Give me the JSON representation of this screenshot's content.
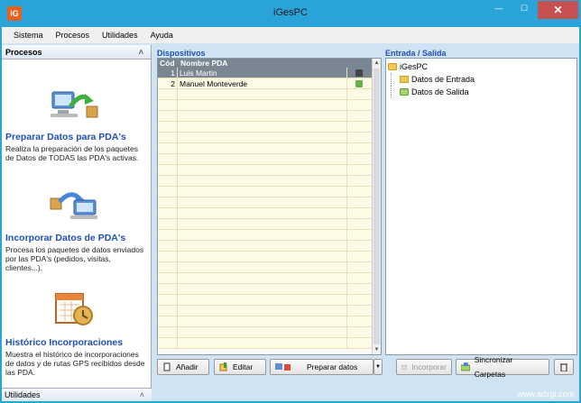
{
  "window": {
    "title": "iGesPC",
    "app_icon_text": "iG",
    "minimize_glyph": "—",
    "maximize_glyph": "☐",
    "close_glyph": "✕"
  },
  "menu": [
    "Sistema",
    "Procesos",
    "Utilidades",
    "Ayuda"
  ],
  "left_pane": {
    "header": "Procesos",
    "collapse_glyph": "˄",
    "footer": "Utilidades",
    "processes": [
      {
        "title": "Preparar Datos para PDA's",
        "description": "Realiza la preparación de los paquetes de Datos de TODAS las PDA's activas.",
        "icon": "computer-to-package-icon"
      },
      {
        "title": "Incorporar Datos de PDA's",
        "description": "Procesa los paquetes de datos enviados por las PDA's (pedidos, visitas, clientes...).",
        "icon": "package-to-computer-icon"
      },
      {
        "title": "Histórico Incorporaciones",
        "description": "Muestra el histórico de incorporaciones de datos y de rutas GPS recibidos desde las PDA.",
        "icon": "history-calendar-icon"
      }
    ]
  },
  "devices": {
    "label": "Dispositivos",
    "columns": [
      "Cód",
      "Nombre PDA"
    ],
    "rows": [
      {
        "cod": "1",
        "name": "Luis Martin",
        "icon": "apple-device-icon",
        "icon_color": "#444444"
      },
      {
        "cod": "2",
        "name": "Manuel Monteverde",
        "icon": "android-device-icon",
        "icon_color": "#6ab04c"
      }
    ]
  },
  "tree": {
    "label": "Entrada / Salida",
    "root": "iGesPC",
    "children": [
      "Datos de Entrada",
      "Datos de Salida"
    ]
  },
  "toolbar": {
    "add": "Añadir",
    "edit": "Editar",
    "prepare": "Preparar datos",
    "incorporate": "Incorporar",
    "sync": "Sincronizar Carpetas"
  },
  "footer_url": "www.adzgi.com",
  "colors": {
    "titlebar": "#2aa3d9",
    "accent_blue": "#1f4fb8",
    "grid_header": "#7a8793",
    "row_bg": "#fdfae6"
  }
}
